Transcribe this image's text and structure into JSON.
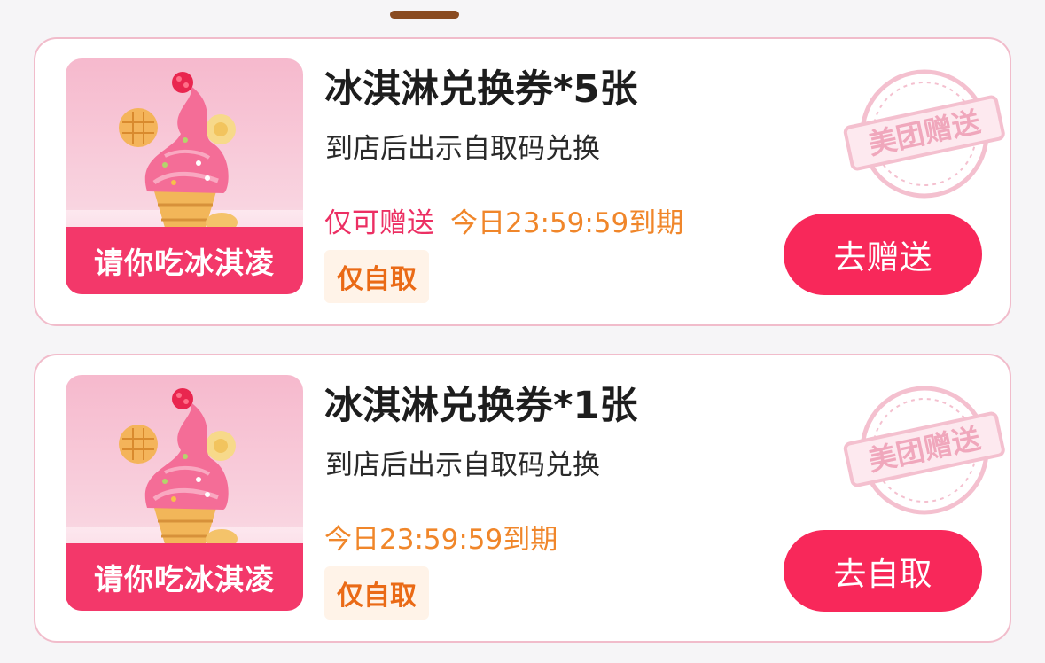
{
  "coupons": [
    {
      "image_label": "请你吃冰淇凌",
      "title": "冰淇淋兑换券*5张",
      "subtitle": "到店后出示自取码兑换",
      "gift_only": "仅可赠送",
      "expiry": "今日23:59:59到期",
      "tag": "仅自取",
      "stamp_text": "美团赠送",
      "action_label": "去赠送"
    },
    {
      "image_label": "请你吃冰淇凌",
      "title": "冰淇淋兑换券*1张",
      "subtitle": "到店后出示自取码兑换",
      "expiry": "今日23:59:59到期",
      "tag": "仅自取",
      "stamp_text": "美团赠送",
      "action_label": "去自取"
    }
  ],
  "colors": {
    "brand_pink": "#f8285a",
    "card_border": "#f1bccb",
    "expiry_orange": "#f0862a",
    "tag_bg": "#fff3e8"
  },
  "icons": [
    "ice-cream-image",
    "meituan-gift-stamp",
    "drag-handle"
  ]
}
